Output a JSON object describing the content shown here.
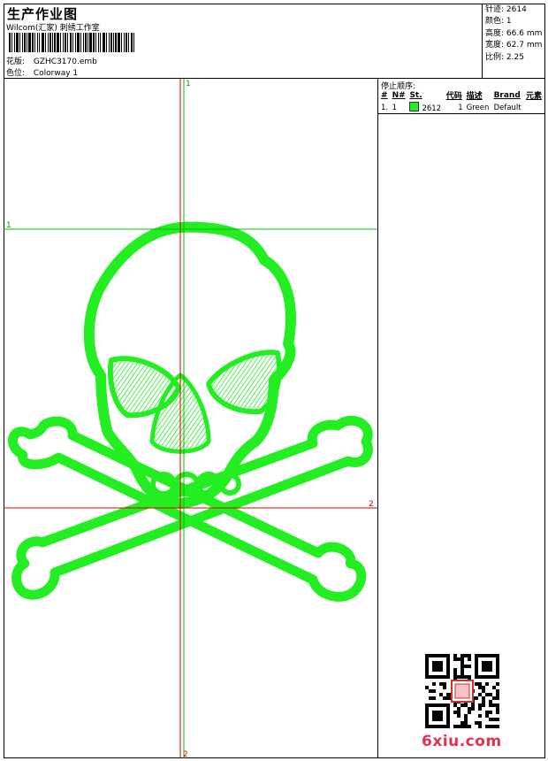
{
  "header": {
    "title": "生产作业图",
    "company": "Wilcom(汇家) 刺绣工作室",
    "design_label": "花版:",
    "design_value": "GZHC3170.emb",
    "colorway_label": "色位:",
    "colorway_value": "Colorway 1"
  },
  "specs": [
    {
      "label": "针迹:",
      "value": "2614"
    },
    {
      "label": "颜色:",
      "value": "1"
    },
    {
      "label": "高度:",
      "value": "66.6 mm"
    },
    {
      "label": "宽度:",
      "value": "62.7 mm"
    },
    {
      "label": "比例:",
      "value": "2.25"
    }
  ],
  "stop_sequence": {
    "title": "停止顺序:",
    "columns": [
      "#",
      "N#",
      "St.",
      "代码",
      "描述",
      "Brand",
      "元素"
    ],
    "rows": [
      {
        "num": "1.",
        "n": "1",
        "color": "#22ee22",
        "st": "2612",
        "code": "1",
        "desc": "Green",
        "brand": "Default",
        "element": ""
      }
    ]
  },
  "guides": {
    "v_green_label_top": "1",
    "v_red_label_bottom": "2",
    "h_green_label_left": "1",
    "h_red_label_right": "2"
  },
  "colors": {
    "stitch": "#22ee22",
    "guide_green": "#00c000",
    "guide_red": "#e00000",
    "watermark": "#e8304d"
  },
  "watermark": {
    "site": "6xiu.com"
  }
}
